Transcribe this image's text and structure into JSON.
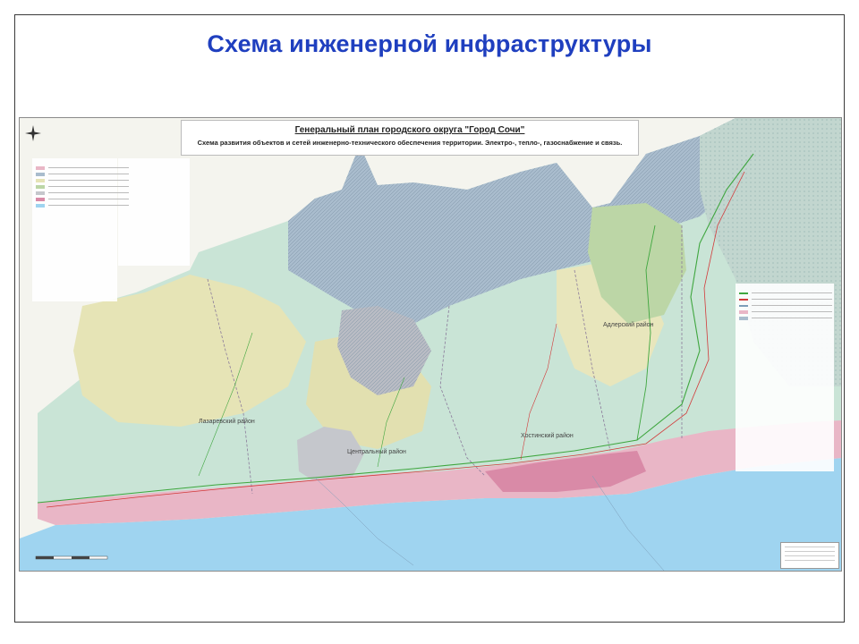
{
  "slide": {
    "title": "Схема инженерной инфраструктуры"
  },
  "map": {
    "title": "Генеральный план городского округа \"Город Сочи\"",
    "subtitle": "Схема развития объектов и сетей инженерно-технического обеспечения территории. Электро-, тепло-, газоснабжение и связь.",
    "districts": [
      {
        "label": "Лазаревский район"
      },
      {
        "label": "Центральный район"
      },
      {
        "label": "Хостинский район"
      },
      {
        "label": "Адлерский район"
      }
    ]
  },
  "colors": {
    "title_blue": "#1f3fbf",
    "sea": "#9fd4f0",
    "forest_blue": "#9fb4c8",
    "land_green": "#bfe0d0",
    "land_yellow": "#e4e2b0",
    "urban_pink": "#e59ab8",
    "network_green": "#3fa63f",
    "network_red": "#d23a3a"
  },
  "icons": {
    "compass": "compass-rose-icon"
  }
}
